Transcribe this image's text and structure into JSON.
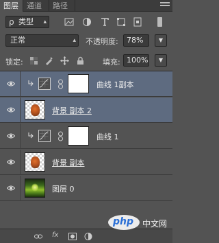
{
  "tabs": [
    {
      "label": "图层"
    },
    {
      "label": "通道"
    },
    {
      "label": "路径"
    }
  ],
  "filter": {
    "kind_label": "类型",
    "search_glyph": "ρ"
  },
  "blend": {
    "mode": "正常",
    "opacity_label": "不透明度:",
    "opacity_value": "78%"
  },
  "lock": {
    "label": "锁定:",
    "fill_label": "填充:",
    "fill_value": "100%"
  },
  "layers": [
    {
      "name": "曲线 1副本",
      "type": "curves",
      "selected": true
    },
    {
      "name": "背景 副本 2",
      "type": "pixel-cutout",
      "selected": true
    },
    {
      "name": "曲线 1",
      "type": "curves",
      "selected": false
    },
    {
      "name": "背景 副本",
      "type": "pixel-cutout",
      "selected": false
    },
    {
      "name": "图层 0",
      "type": "photo",
      "selected": false
    }
  ],
  "watermark": {
    "logo": "php",
    "text": "中文网"
  },
  "colors": {
    "panel": "#535353",
    "selected": "#5e6b80",
    "tabbar": "#3c3c3c"
  }
}
